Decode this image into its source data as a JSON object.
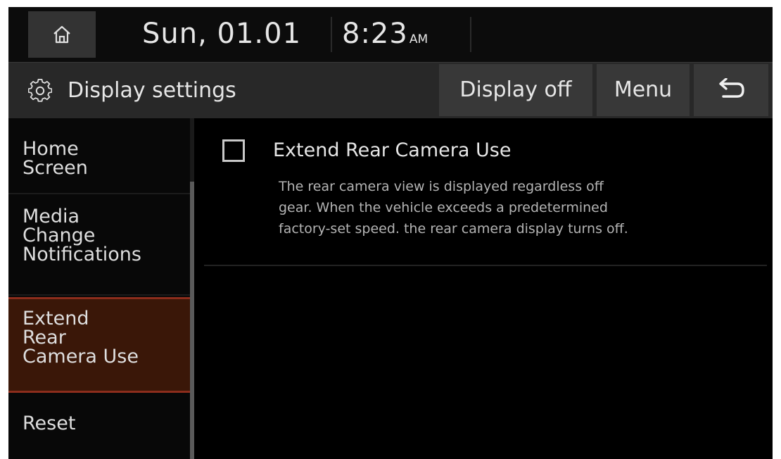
{
  "colors": {
    "screen_bg": "#000000",
    "bar_bg": "#282828",
    "button_bg": "#383838",
    "selected_bg": "#3a1708",
    "selected_border": "#8c2d1c"
  },
  "status_bar": {
    "home_icon": "home-icon",
    "date": "Sun, 01.01",
    "time": "8:23",
    "ampm": "AM"
  },
  "title_bar": {
    "settings_icon": "gear-icon",
    "title": "Display settings",
    "display_off_label": "Display off",
    "menu_label": "Menu",
    "back_icon": "back-arrow-icon"
  },
  "sidebar": {
    "items": [
      {
        "lines": [
          "Home",
          "Screen"
        ],
        "selected": false
      },
      {
        "lines": [
          "Media",
          "Change",
          "Notifications"
        ],
        "selected": false
      },
      {
        "lines": [
          "Extend",
          "Rear",
          "Camera Use"
        ],
        "selected": true
      },
      {
        "lines": [
          "Reset"
        ],
        "selected": false
      }
    ]
  },
  "main": {
    "option": {
      "checked": false,
      "title": "Extend Rear Camera Use",
      "description_lines": [
        "The rear camera view is displayed regardless off",
        "gear. When the vehicle exceeds a predetermined",
        "factory-set speed. the rear camera display turns off."
      ]
    }
  }
}
